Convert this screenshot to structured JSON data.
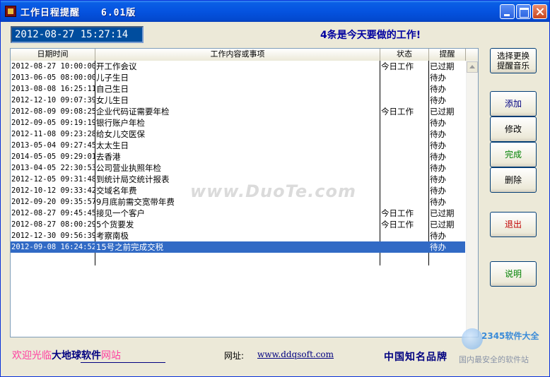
{
  "window": {
    "title": "工作日程提醒",
    "version": "6.01版"
  },
  "clock": "2012-08-27 15:27:14",
  "today_message": "4条是今天要做的工作!",
  "table": {
    "columns": [
      "日期时间",
      "工作内容或事项",
      "状态",
      "提醒"
    ],
    "rows": [
      {
        "date": "2012-08-27 10:00:00",
        "task": "开工作会议",
        "status": "今日工作",
        "remind": "已过期"
      },
      {
        "date": "2013-06-05 08:00:00",
        "task": "儿子生日",
        "status": "",
        "remind": "待办"
      },
      {
        "date": "2013-08-08 16:25:11",
        "task": "自己生日",
        "status": "",
        "remind": "待办"
      },
      {
        "date": "2012-12-10 09:07:39",
        "task": "女儿生日",
        "status": "",
        "remind": "待办"
      },
      {
        "date": "2012-08-09 09:08:25",
        "task": "企业代码证需要年检",
        "status": "今日工作",
        "remind": "已过期"
      },
      {
        "date": "2012-09-05 09:19:19",
        "task": "银行账户年检",
        "status": "",
        "remind": "待办"
      },
      {
        "date": "2012-11-08 09:23:28",
        "task": "给女儿交医保",
        "status": "",
        "remind": "待办"
      },
      {
        "date": "2013-05-04 09:27:45",
        "task": "太太生日",
        "status": "",
        "remind": "待办"
      },
      {
        "date": "2014-05-05 09:29:01",
        "task": "去香港",
        "status": "",
        "remind": "待办"
      },
      {
        "date": "2013-04-05 22:30:53",
        "task": "公司营业执照年检",
        "status": "",
        "remind": "待办"
      },
      {
        "date": "2012-12-05 09:31:48",
        "task": "到统计局交统计报表",
        "status": "",
        "remind": "待办"
      },
      {
        "date": "2012-10-12 09:33:42",
        "task": "交域名年费",
        "status": "",
        "remind": "待办"
      },
      {
        "date": "2012-09-20 09:35:57",
        "task": "9月底前需交宽带年费",
        "status": "",
        "remind": "待办"
      },
      {
        "date": "2012-08-27 09:45:45",
        "task": "接见一个客户",
        "status": "今日工作",
        "remind": "已过期"
      },
      {
        "date": "2012-08-27 08:00:29",
        "task": "5个货要发",
        "status": "今日工作",
        "remind": "已过期"
      },
      {
        "date": "2012-12-30 09:56:39",
        "task": "考察南极",
        "status": "",
        "remind": "待办"
      },
      {
        "date": "2012-09-08 16:24:52",
        "task": "15号之前完成交税",
        "status": "",
        "remind": "待办"
      }
    ]
  },
  "buttons": {
    "music_line1": "选择更换",
    "music_line2": "提醒音乐",
    "add": "添加",
    "edit": "修改",
    "done": "完成",
    "delete": "删除",
    "exit": "退出",
    "help": "说明"
  },
  "button_colors": {
    "add": "#000080",
    "edit": "#000000",
    "done": "#008000",
    "delete": "#000000",
    "exit": "#c00000",
    "help": "#008000"
  },
  "footer": {
    "welcome_pre": "欢迎光临",
    "welcome_mid": "大地球软件",
    "welcome_post": "网站",
    "url_label": "网址:",
    "url": "www.ddqsoft.com",
    "brand": "中国知名品牌"
  },
  "watermarks": {
    "center": "www.DuoTe.com",
    "logo": "2345软件大全",
    "sub": "国内最安全的软件站"
  }
}
